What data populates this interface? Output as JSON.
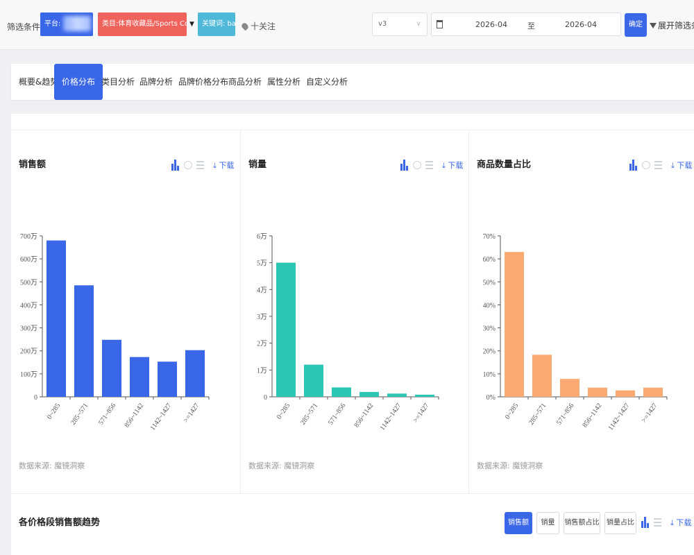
{
  "filter": {
    "label": "筛选条件:",
    "platform_tag": "平台:",
    "category_tag": "类目:体育收藏品/Sports Collectibles",
    "keyword_tag": "关键词: ball",
    "follow": "十关注",
    "version": "v3",
    "date_from": "2026-04",
    "date_to_sep": "至",
    "date_to": "2026-04",
    "confirm": "确定",
    "expand": "展开筛选条件"
  },
  "tabs": [
    {
      "label": "概要&趋势"
    },
    {
      "label": "价格分布"
    },
    {
      "label": "类目分析"
    },
    {
      "label": "品牌分析"
    },
    {
      "label": "品牌价格分布"
    },
    {
      "label": "商品分析"
    },
    {
      "label": "属性分析"
    },
    {
      "label": "自定义分析"
    }
  ],
  "active_tab": "价格分布",
  "download_label": "下载",
  "source_text": "数据来源: 魔镜洞察",
  "cards": [
    {
      "title": "销售额"
    },
    {
      "title": "销量"
    },
    {
      "title": "商品数量占比"
    }
  ],
  "chart_data": [
    {
      "type": "bar",
      "title": "销售额",
      "categories": [
        "0~285",
        "285~571",
        "571~856",
        "856~1142",
        "1142~1427",
        ">=1427"
      ],
      "values": [
        6800000,
        4850000,
        2480000,
        1730000,
        1530000,
        2030000
      ],
      "ylim": [
        0,
        7000000
      ],
      "ytick_values": [
        0,
        1000000,
        2000000,
        3000000,
        4000000,
        5000000,
        6000000,
        7000000
      ],
      "ytick_labels": [
        "0",
        "100万",
        "200万",
        "300万",
        "400万",
        "500万",
        "600万",
        "700万"
      ],
      "color": "#3a66e8"
    },
    {
      "type": "bar",
      "title": "销量",
      "categories": [
        "0~285",
        "285~571",
        "571~856",
        "856~1142",
        "1142~1427",
        ">=1427"
      ],
      "values": [
        50000,
        12000,
        3500,
        1800,
        1200,
        800
      ],
      "ylim": [
        0,
        60000
      ],
      "ytick_values": [
        0,
        10000,
        20000,
        30000,
        40000,
        50000,
        60000
      ],
      "ytick_labels": [
        "0",
        "1万",
        "2万",
        "3万",
        "4万",
        "5万",
        "6万"
      ],
      "color": "#2cc6b4"
    },
    {
      "type": "bar",
      "title": "商品数量占比",
      "categories": [
        "0~285",
        "285~571",
        "571~856",
        "856~1142",
        "1142~1427",
        ">=1427"
      ],
      "values": [
        63,
        18.3,
        7.8,
        4,
        2.8,
        4
      ],
      "ylim": [
        0,
        70
      ],
      "ytick_values": [
        0,
        10,
        20,
        30,
        40,
        50,
        60,
        70
      ],
      "ytick_labels": [
        "0%",
        "10%",
        "20%",
        "30%",
        "40%",
        "50%",
        "60%",
        "70%"
      ],
      "color": "#fbaa72"
    }
  ],
  "trend": {
    "title": "各价格段销售额趋势",
    "buttons": [
      {
        "label": "销售额",
        "active": true
      },
      {
        "label": "销量",
        "active": false
      },
      {
        "label": "销售额占比",
        "active": false
      },
      {
        "label": "销量占比",
        "active": false
      }
    ]
  }
}
